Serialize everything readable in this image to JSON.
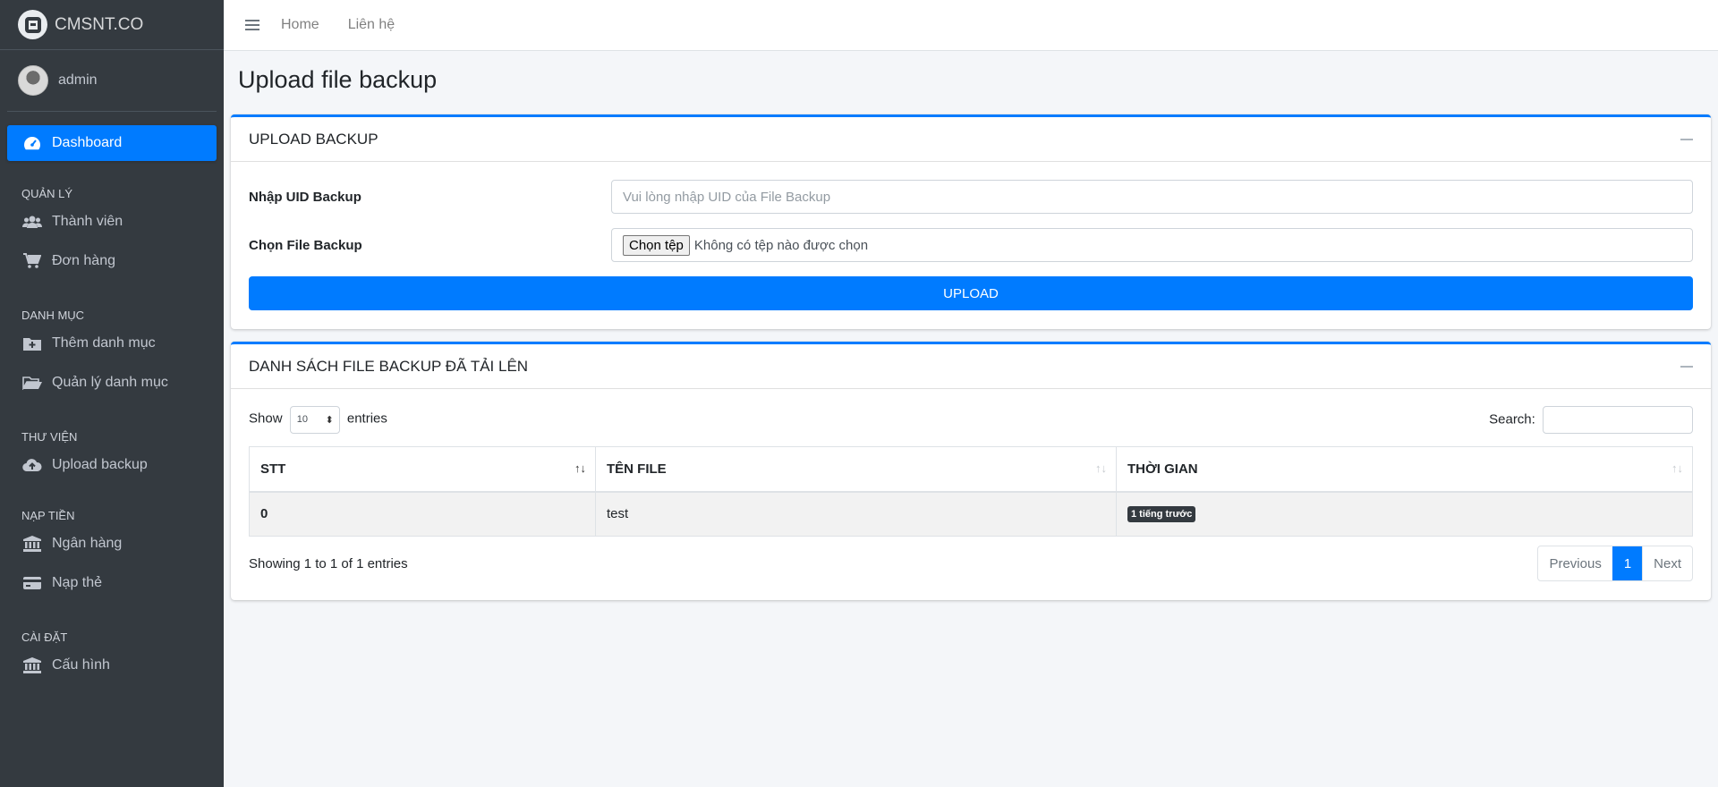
{
  "brand": {
    "name": "CMSNT.CO"
  },
  "user": {
    "name": "admin"
  },
  "sidebar": {
    "dashboard": "Dashboard",
    "sections": [
      {
        "header": "QUẢN LÝ",
        "items": [
          {
            "label": "Thành viên",
            "icon": "users-icon"
          },
          {
            "label": "Đơn hàng",
            "icon": "cart-icon"
          }
        ]
      },
      {
        "header": "DANH MỤC",
        "items": [
          {
            "label": "Thêm danh mục",
            "icon": "folder-plus-icon"
          },
          {
            "label": "Quản lý danh mục",
            "icon": "folder-open-icon"
          }
        ]
      },
      {
        "header": "THƯ VIỆN",
        "items": [
          {
            "label": "Upload backup",
            "icon": "cloud-upload-icon"
          }
        ]
      },
      {
        "header": "NẠP TIỀN",
        "items": [
          {
            "label": "Ngân hàng",
            "icon": "bank-icon"
          },
          {
            "label": "Nạp thẻ",
            "icon": "credit-card-icon"
          }
        ]
      },
      {
        "header": "CÀI ĐẶT",
        "items": [
          {
            "label": "Cấu hình",
            "icon": "bank-icon"
          }
        ]
      }
    ]
  },
  "topbar": {
    "home": "Home",
    "contact": "Liên hệ"
  },
  "page": {
    "title": "Upload file backup"
  },
  "upload_card": {
    "title": "UPLOAD BACKUP",
    "uid_label": "Nhập UID Backup",
    "uid_placeholder": "Vui lòng nhập UID của File Backup",
    "file_label": "Chọn File Backup",
    "file_button": "Chọn tệp",
    "file_status": "Không có tệp nào được chọn",
    "submit": "UPLOAD"
  },
  "list_card": {
    "title": "DANH SÁCH FILE BACKUP ĐÃ TẢI LÊN",
    "show_label": "Show",
    "entries_label": "entries",
    "page_size": "10",
    "search_label": "Search:",
    "columns": [
      "STT",
      "TÊN FILE",
      "THỜI GIAN"
    ],
    "rows": [
      {
        "stt": "0",
        "file": "test",
        "time": "1 tiếng trước"
      }
    ],
    "info": "Showing 1 to 1 of 1 entries",
    "pagination": {
      "previous": "Previous",
      "current": "1",
      "next": "Next"
    }
  },
  "colors": {
    "primary": "#007bff",
    "sidebar": "#343a40",
    "badge": "#343a40"
  }
}
